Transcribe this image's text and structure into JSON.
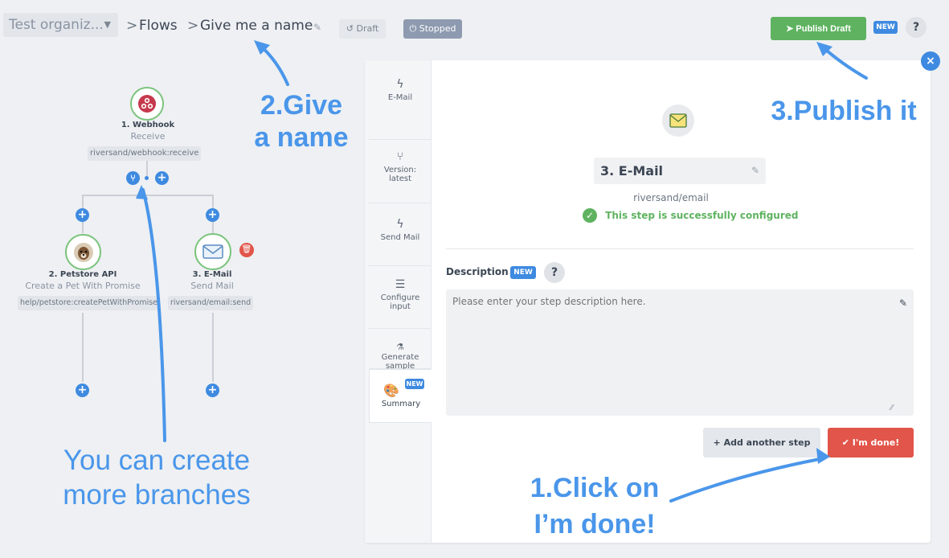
{
  "header": {
    "org_select": "Test organiz...",
    "breadcrumb_sep": ">",
    "crumb_flows": "Flows",
    "flow_name": "Give me a name",
    "draft_label": "Draft",
    "stopped_label": "Stopped",
    "publish_label": "Publish Draft",
    "new_badge": "NEW",
    "help": "?"
  },
  "flow": {
    "nodes": [
      {
        "title": "1. Webhook",
        "subtitle": "Receive",
        "path": "riversand/webhook:receive",
        "icon": "webhook-icon"
      },
      {
        "title": "2. Petstore API",
        "subtitle": "Create a Pet With Promise",
        "path": "help/petstore:createPetWithPromise",
        "icon": "dog-avatar-icon"
      },
      {
        "title": "3. E-Mail",
        "subtitle": "Send Mail",
        "path": "riversand/email:send",
        "icon": "envelope-icon"
      }
    ]
  },
  "annotations": {
    "give_name_1": "2.Give",
    "give_name_2": "a name",
    "publish": "3.Publish it",
    "branches_1": "You can create",
    "branches_2": "more branches",
    "click_1": "1.Click on",
    "click_2": "I’m done!"
  },
  "panel": {
    "tabs": [
      {
        "label": "E-Mail",
        "icon": "bolt-icon"
      },
      {
        "label": "Version:\nlatest",
        "icon": "branch-icon"
      },
      {
        "label": "Send Mail",
        "icon": "bolt-icon"
      },
      {
        "label": "Configure\ninput",
        "icon": "menu-icon"
      },
      {
        "label": "Generate\nsample",
        "icon": "flask-icon"
      },
      {
        "label": "Summary",
        "icon": "palette-icon",
        "badge": "NEW"
      }
    ],
    "step_name": "3. E-Mail",
    "component": "riversand/email",
    "status": "This step is successfully configured",
    "description_label": "Description",
    "description_badge": "NEW",
    "description_help": "?",
    "description_placeholder": "Please enter your step description here.",
    "add_step_label": "Add another step",
    "done_label": "I'm done!"
  },
  "colors": {
    "accent": "#3e8ae0",
    "success": "#5fb360",
    "danger": "#e2554a",
    "annotation": "#4a96ea"
  }
}
